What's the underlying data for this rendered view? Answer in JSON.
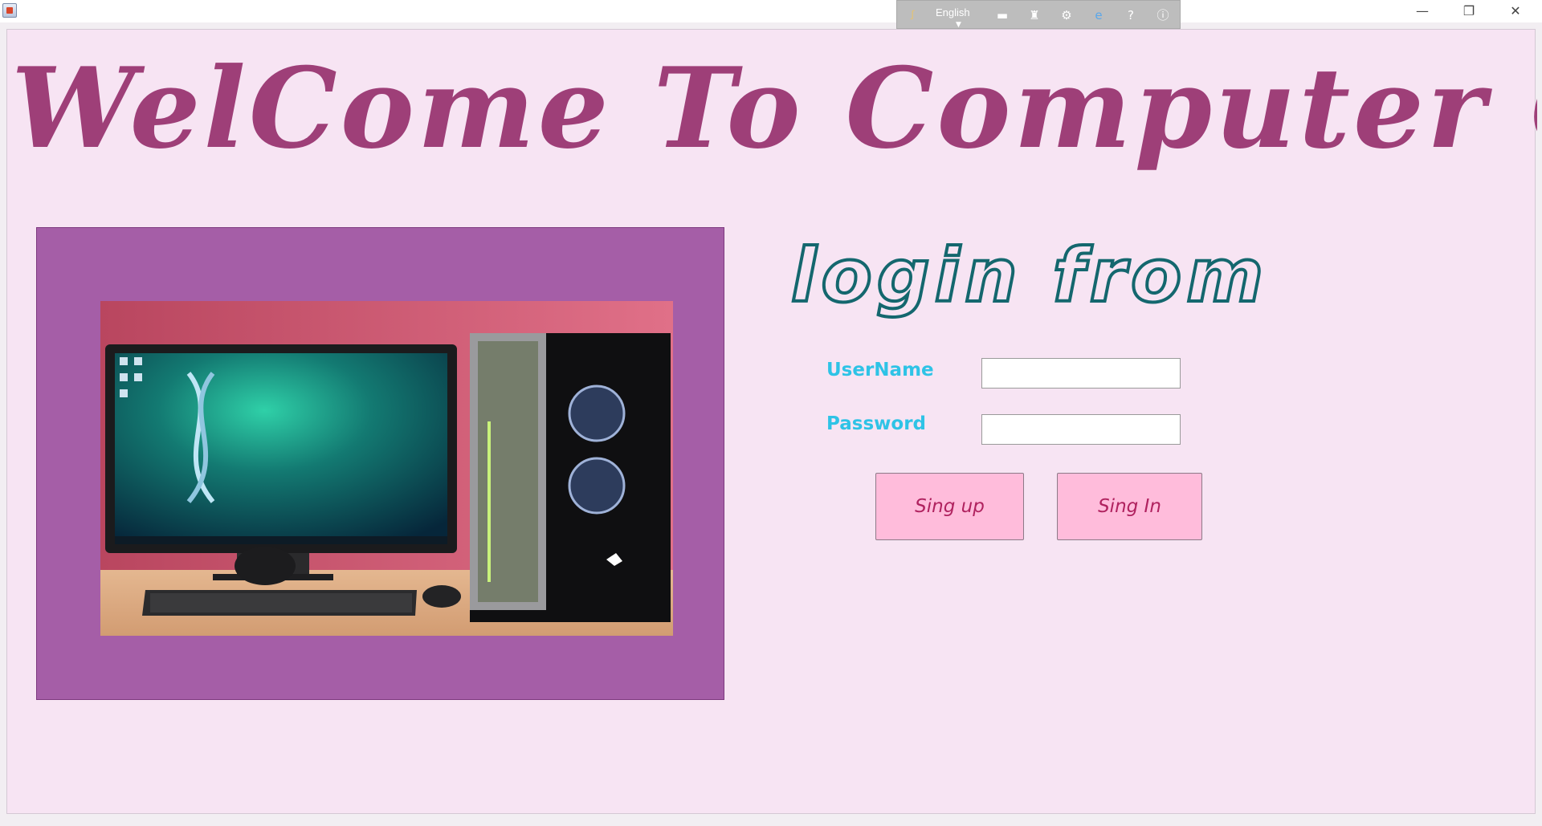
{
  "window": {
    "title": "",
    "controls": {
      "minimize": "—",
      "restore": "❐",
      "close": "✕"
    }
  },
  "ime_toolbar": {
    "language": "English",
    "icons": [
      "ime-logo-icon",
      "keyboard-icon",
      "pen-icon",
      "gear-icon",
      "browser-icon",
      "help-icon",
      "info-icon"
    ]
  },
  "header": {
    "welcome_text": "WelCome To Computer Center"
  },
  "login": {
    "title": "login from",
    "username_label": "UserName",
    "password_label": "Password",
    "username_value": "",
    "password_value": "",
    "signup_label": "Sing up",
    "signin_label": "Sing In"
  },
  "colors": {
    "panel_bg": "#f7e4f3",
    "welcome_text": "#9e3f78",
    "image_frame": "#a55ea7",
    "login_title_outline": "#14676e",
    "field_label": "#2ec3e6",
    "button_bg": "#ffbcdb",
    "button_text": "#b0225f"
  }
}
